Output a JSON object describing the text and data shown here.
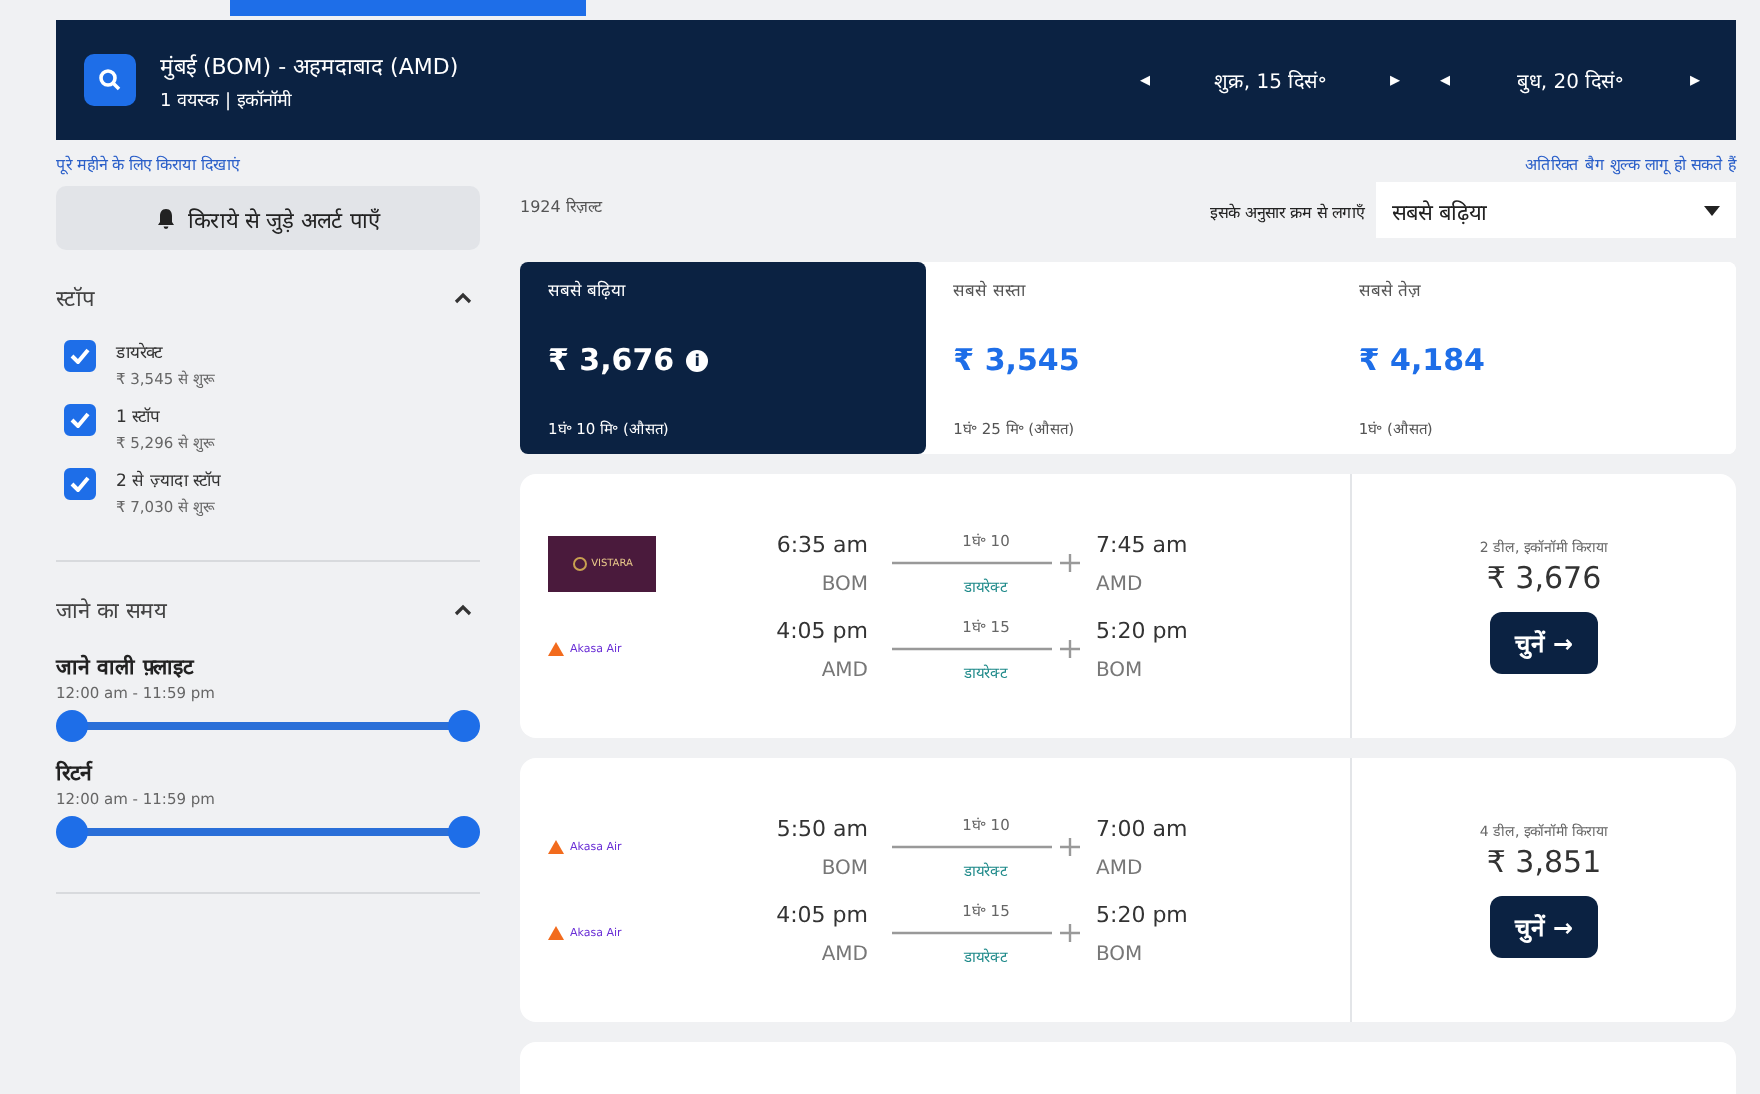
{
  "search_summary": {
    "route": "मुंबई (BOM) - अहमदाबाद (AMD)",
    "details": "1 वयस्क | इकॉनॉमी"
  },
  "dates": [
    {
      "label": "शुक्र, 15 दिसं॰",
      "prev": "◂",
      "next": "▸"
    },
    {
      "label": "बुध, 20 दिसं॰",
      "prev": "◂",
      "next": "▸"
    }
  ],
  "month_link": "पूरे महीने के लिए किराया दिखाएं",
  "bag_fee_link": "अतिरिक्त बैग शुल्क लागू हो सकते हैं",
  "alert_button": "किराये से जुड़े अलर्ट पाएँ",
  "result_count": "1924 रिज़ल्ट",
  "sort": {
    "label": "इसके अनुसार क्रम से लगाएँ",
    "value": "सबसे बढ़िया"
  },
  "filters": {
    "stops": {
      "title": "स्टॉप",
      "expanded": true,
      "options": [
        {
          "label": "डायरेक्ट",
          "price": "₹ 3,545 से शुरू",
          "checked": true
        },
        {
          "label": "1 स्टॉप",
          "price": "₹ 5,296 से शुरू",
          "checked": true
        },
        {
          "label": "2 से ज़्यादा स्टॉप",
          "price": "₹ 7,030 से शुरू",
          "checked": true
        }
      ]
    },
    "times": {
      "title": "जाने का समय",
      "expanded": true,
      "sliders": [
        {
          "label": "जाने वाली फ़्लाइट",
          "range": "12:00 am - 11:59 pm",
          "level": 1
        },
        {
          "label": "रिटर्न",
          "range": "12:00 am - 11:59 pm",
          "level": 1
        }
      ]
    }
  },
  "sort_tabs": [
    {
      "label": "सबसे बढ़िया",
      "price": "₹ 3,676",
      "info": "i",
      "duration": "1घं॰ 10 मि॰ (औसत)",
      "selected": true
    },
    {
      "label": "सबसे सस्ता",
      "price": "₹ 3,545",
      "duration": "1घं॰ 25 मि॰ (औसत)",
      "selected": false
    },
    {
      "label": "सबसे तेज़",
      "price": "₹ 4,184",
      "duration": "1घं॰ (औसत)",
      "selected": false
    }
  ],
  "results": [
    {
      "legs": [
        {
          "airline": "VISTARA",
          "kind": "vistara",
          "depart": "6:35 am",
          "from": "BOM",
          "duration": "1घं॰ 10",
          "stops": "डायरेक्ट",
          "arrive": "7:45 am",
          "to": "AMD"
        },
        {
          "airline": "Akasa Air",
          "kind": "akasa",
          "depart": "4:05 pm",
          "from": "AMD",
          "duration": "1घं॰ 15",
          "stops": "डायरेक्ट",
          "arrive": "5:20 pm",
          "to": "BOM"
        }
      ],
      "deals": "2 डील, इकॉनॉमी किराया",
      "price": "₹ 3,676",
      "button": "चुनें →"
    },
    {
      "legs": [
        {
          "airline": "Akasa Air",
          "kind": "akasa",
          "depart": "5:50 am",
          "from": "BOM",
          "duration": "1घं॰ 10",
          "stops": "डायरेक्ट",
          "arrive": "7:00 am",
          "to": "AMD"
        },
        {
          "airline": "Akasa Air",
          "kind": "akasa",
          "depart": "4:05 pm",
          "from": "AMD",
          "duration": "1घं॰ 15",
          "stops": "डायरेक्ट",
          "arrive": "5:20 pm",
          "to": "BOM"
        }
      ],
      "deals": "4 डील, इकॉनॉमी किराया",
      "price": "₹ 3,851",
      "button": "चुनें →"
    }
  ]
}
